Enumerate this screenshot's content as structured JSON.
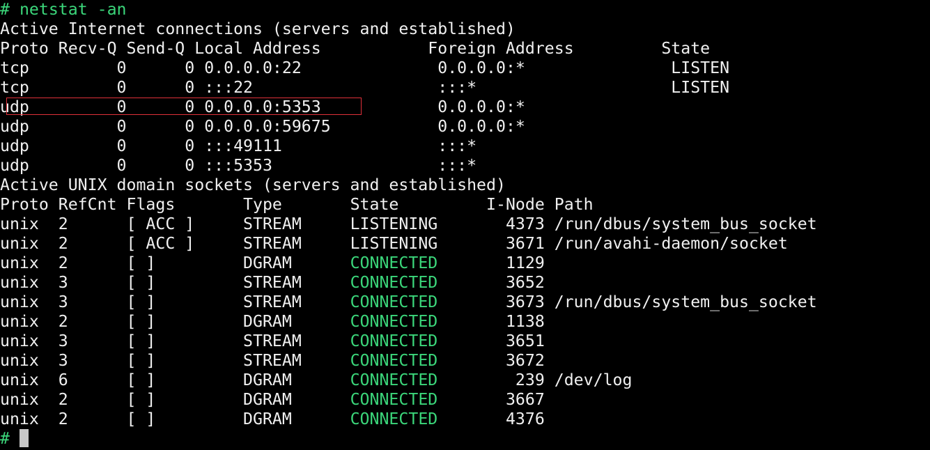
{
  "prompt_symbol": "#",
  "command": "netstat -an",
  "inet_section": {
    "heading": "Active Internet connections (servers and established)",
    "header": {
      "proto": "Proto",
      "recvq": "Recv-Q",
      "sendq": "Send-Q",
      "local": "Local Address",
      "foreign": "Foreign Address",
      "state": "State"
    },
    "rows": [
      {
        "proto": "tcp",
        "recvq": "0",
        "sendq": "0",
        "local": "0.0.0.0:22",
        "foreign": "0.0.0.0:*",
        "state": "LISTEN"
      },
      {
        "proto": "tcp",
        "recvq": "0",
        "sendq": "0",
        "local": ":::22",
        "foreign": ":::*",
        "state": "LISTEN"
      },
      {
        "proto": "udp",
        "recvq": "0",
        "sendq": "0",
        "local": "0.0.0.0:5353",
        "foreign": "0.0.0.0:*",
        "state": ""
      },
      {
        "proto": "udp",
        "recvq": "0",
        "sendq": "0",
        "local": "0.0.0.0:59675",
        "foreign": "0.0.0.0:*",
        "state": ""
      },
      {
        "proto": "udp",
        "recvq": "0",
        "sendq": "0",
        "local": ":::49111",
        "foreign": ":::*",
        "state": ""
      },
      {
        "proto": "udp",
        "recvq": "0",
        "sendq": "0",
        "local": ":::5353",
        "foreign": ":::*",
        "state": ""
      }
    ]
  },
  "unix_section": {
    "heading": "Active UNIX domain sockets (servers and established)",
    "header": {
      "proto": "Proto",
      "refcnt": "RefCnt",
      "flags": "Flags",
      "type": "Type",
      "state": "State",
      "inode": "I-Node",
      "path": "Path"
    },
    "rows": [
      {
        "proto": "unix",
        "refcnt": "2",
        "flags": "[ ACC ]",
        "type": "STREAM",
        "state": "LISTENING",
        "inode": "4373",
        "path": "/run/dbus/system_bus_socket"
      },
      {
        "proto": "unix",
        "refcnt": "2",
        "flags": "[ ACC ]",
        "type": "STREAM",
        "state": "LISTENING",
        "inode": "3671",
        "path": "/run/avahi-daemon/socket"
      },
      {
        "proto": "unix",
        "refcnt": "2",
        "flags": "[ ]",
        "type": "DGRAM",
        "state": "CONNECTED",
        "inode": "1129",
        "path": ""
      },
      {
        "proto": "unix",
        "refcnt": "3",
        "flags": "[ ]",
        "type": "STREAM",
        "state": "CONNECTED",
        "inode": "3652",
        "path": ""
      },
      {
        "proto": "unix",
        "refcnt": "3",
        "flags": "[ ]",
        "type": "STREAM",
        "state": "CONNECTED",
        "inode": "3673",
        "path": "/run/dbus/system_bus_socket"
      },
      {
        "proto": "unix",
        "refcnt": "2",
        "flags": "[ ]",
        "type": "DGRAM",
        "state": "CONNECTED",
        "inode": "1138",
        "path": ""
      },
      {
        "proto": "unix",
        "refcnt": "3",
        "flags": "[ ]",
        "type": "STREAM",
        "state": "CONNECTED",
        "inode": "3651",
        "path": ""
      },
      {
        "proto": "unix",
        "refcnt": "3",
        "flags": "[ ]",
        "type": "STREAM",
        "state": "CONNECTED",
        "inode": "3672",
        "path": ""
      },
      {
        "proto": "unix",
        "refcnt": "6",
        "flags": "[ ]",
        "type": "DGRAM",
        "state": "CONNECTED",
        "inode": "239",
        "path": "/dev/log"
      },
      {
        "proto": "unix",
        "refcnt": "2",
        "flags": "[ ]",
        "type": "DGRAM",
        "state": "CONNECTED",
        "inode": "3667",
        "path": ""
      },
      {
        "proto": "unix",
        "refcnt": "2",
        "flags": "[ ]",
        "type": "DGRAM",
        "state": "CONNECTED",
        "inode": "4376",
        "path": ""
      }
    ]
  },
  "colors": {
    "background": "#000000",
    "text": "#f0f0f0",
    "prompt": "#3bd67a",
    "connected": "#3bd67a",
    "highlight_box": "#e0303a",
    "cursor": "#c8c8c8"
  }
}
